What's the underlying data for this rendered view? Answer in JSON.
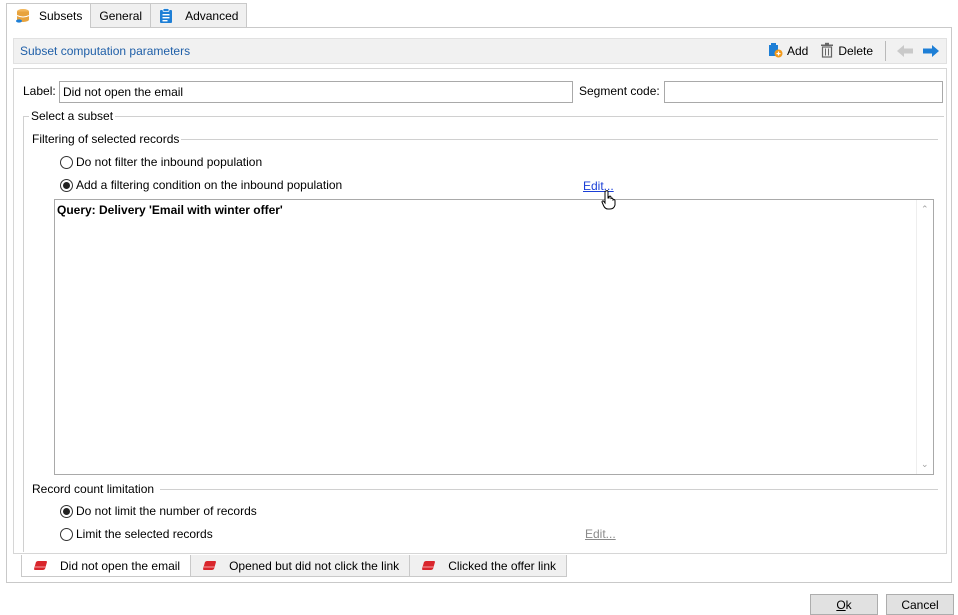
{
  "tabs": {
    "subsets": "Subsets",
    "general": "General",
    "advanced": "Advanced"
  },
  "section": {
    "title": "Subset computation parameters",
    "add_label": "Add",
    "delete_label": "Delete"
  },
  "form": {
    "label_caption": "Label:",
    "label_value": "Did not open the email",
    "segment_caption": "Segment code:",
    "segment_value": ""
  },
  "select_subset": {
    "legend": "Select a subset",
    "filtering_legend": "Filtering of selected records",
    "option_no_filter": "Do not filter the inbound population",
    "option_add_condition": "Add a filtering condition on the inbound population",
    "selected_filter_option": "option_add_condition",
    "edit_link": "Edit...",
    "query_text": "Query: Delivery 'Email with winter offer'"
  },
  "record_limit": {
    "legend": "Record count limitation",
    "option_no_limit": "Do not limit the number of records",
    "option_limit": "Limit the selected records",
    "selected_limit_option": "option_no_limit",
    "edit_link": "Edit..."
  },
  "subset_tabs": [
    {
      "label": "Did not open the email",
      "active": true
    },
    {
      "label": "Opened but did not click the link",
      "active": false
    },
    {
      "label": "Clicked the offer link",
      "active": false
    }
  ],
  "dialog": {
    "ok_prefix": "",
    "ok_mnemonic": "O",
    "ok_rest": "k",
    "cancel_label": "Cancel"
  },
  "colors": {
    "accent": "#1f5fa8",
    "subset_icon": "#e8a33d",
    "tab_icon_red": "#d9262c",
    "nav_arrow_active": "#1e7fd6",
    "nav_arrow_inactive": "#c9c9c9"
  }
}
